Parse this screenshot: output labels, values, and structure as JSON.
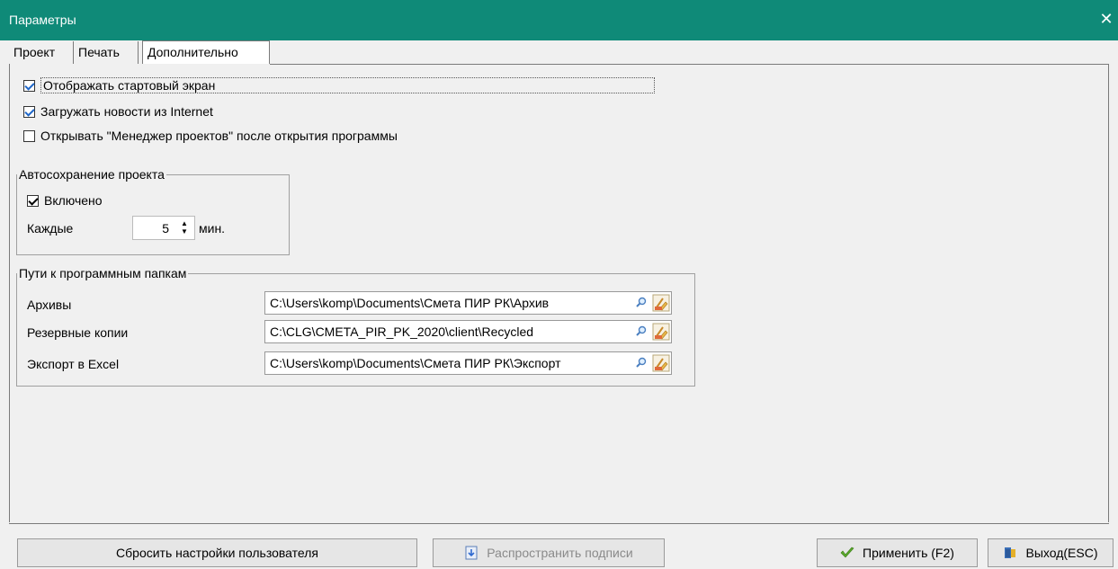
{
  "window": {
    "title": "Параметры",
    "close_glyph": "✕"
  },
  "tabs": [
    {
      "label": "Проект"
    },
    {
      "label": "Печать"
    },
    {
      "label": "Дополнительно"
    }
  ],
  "options": {
    "show_start_screen": {
      "label": "Отображать стартовый экран",
      "checked": true
    },
    "load_news": {
      "label": "Загружать новости из Internet",
      "checked": true
    },
    "open_manager": {
      "label": "Открывать \"Менеджер проектов\" после открытия программы",
      "checked": false
    }
  },
  "autosave": {
    "group_title": "Автосохранение проекта",
    "enabled_label": "Включено",
    "enabled": true,
    "every_label": "Каждые",
    "interval_value": "5",
    "unit": "мин.",
    "spin_up": "▲",
    "spin_down": "▼"
  },
  "paths": {
    "group_title": "Пути к программным папкам",
    "rows": [
      {
        "label": "Архивы",
        "value": "C:\\Users\\komp\\Documents\\Смета ПИР РК\\Архив"
      },
      {
        "label": "Резервные копии",
        "value": "C:\\CLG\\CMETA_PIR_PK_2020\\client\\Recycled"
      },
      {
        "label": "Экспорт в Excel",
        "value": "C:\\Users\\komp\\Documents\\Смета ПИР РК\\Экспорт"
      }
    ],
    "icons": [
      "magnifier-icon",
      "folder-broom-icon"
    ]
  },
  "buttons": {
    "reset": "Сбросить настройки пользователя",
    "distribute": "Распространить подписи",
    "apply": "Применить (F2)",
    "exit": "Выход(ESC)"
  },
  "colors": {
    "titlebar": "#0f8a78",
    "accent": "#1e66c8"
  }
}
